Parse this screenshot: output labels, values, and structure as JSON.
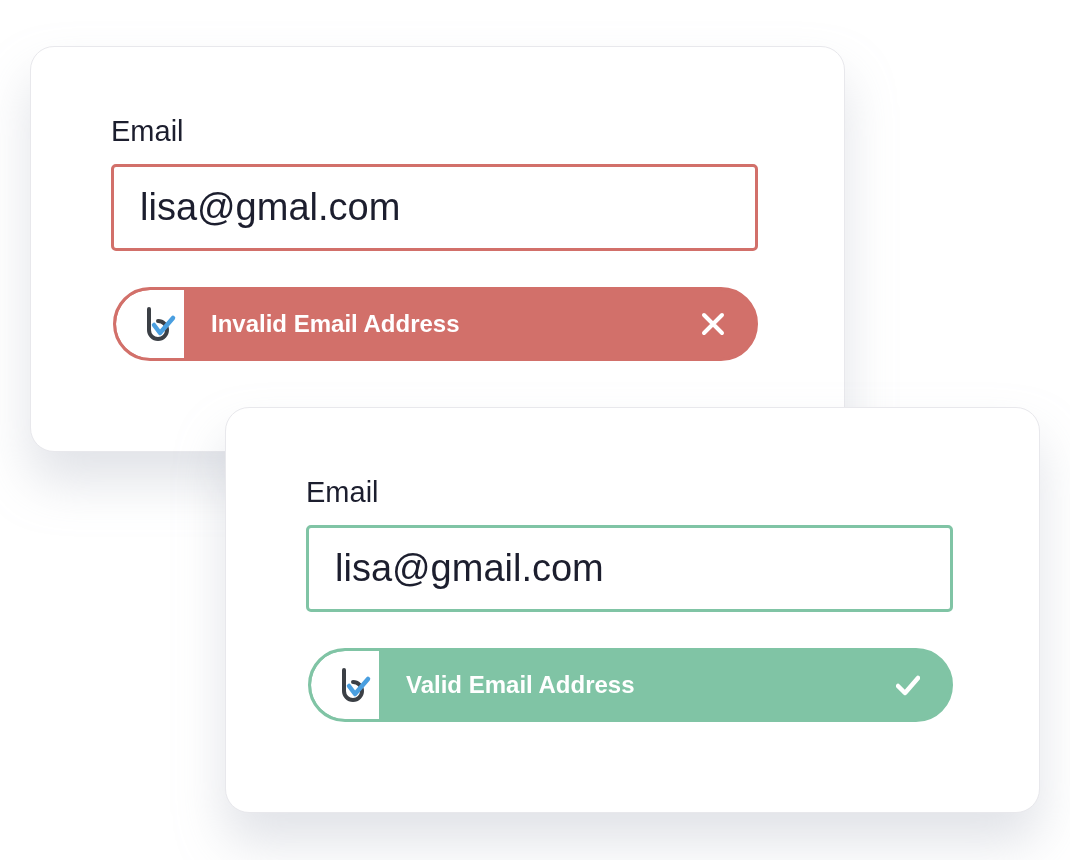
{
  "cards": [
    {
      "label": "Email",
      "value": "lisa@gmal.com",
      "valid": false,
      "message": "Invalid Email Address"
    },
    {
      "label": "Email",
      "value": "lisa@gmail.com",
      "valid": true,
      "message": "Valid Email Address"
    }
  ]
}
